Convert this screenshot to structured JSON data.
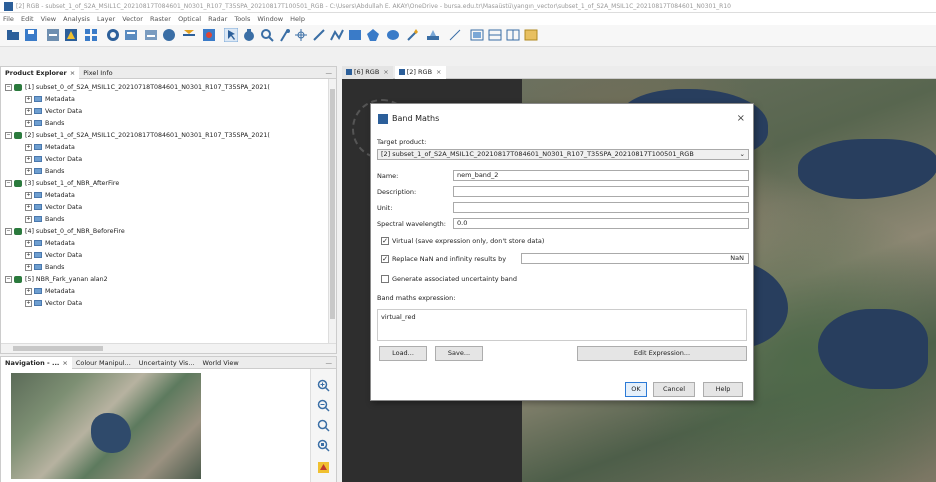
{
  "window": {
    "title": "[2] RGB - subset_1_of_S2A_MSIL1C_20210817T084601_N0301_R107_T35SPA_20210817T100501_RGB - C:\\Users\\Abdullah E. AKAY\\OneDrive - bursa.edu.tr\\Masaüstü\\yangın_vector\\subset_1_of_S2A_MSIL1C_20210817T084601_N0301_R10"
  },
  "menu": [
    "File",
    "Edit",
    "View",
    "Analysis",
    "Layer",
    "Vector",
    "Raster",
    "Optical",
    "Radar",
    "Tools",
    "Window",
    "Help"
  ],
  "product_explorer": {
    "tabs": [
      "Product Explorer",
      "Pixel Info"
    ],
    "close_glyph": "×",
    "minimize_glyph": "—",
    "expand_glyph": "−",
    "collapse_glyph": "+",
    "items": [
      {
        "label": "[1] subset_0_of_S2A_MSIL1C_20210718T084601_N0301_R107_T35SPA_2021(",
        "level": 0
      },
      {
        "label": "Metadata",
        "level": 1
      },
      {
        "label": "Vector Data",
        "level": 1
      },
      {
        "label": "Bands",
        "level": 1
      },
      {
        "label": "[2] subset_1_of_S2A_MSIL1C_20210817T084601_N0301_R107_T35SPA_2021(",
        "level": 0
      },
      {
        "label": "Metadata",
        "level": 1
      },
      {
        "label": "Vector Data",
        "level": 1
      },
      {
        "label": "Bands",
        "level": 1
      },
      {
        "label": "[3] subset_1_of_NBR_AfterFire",
        "level": 0
      },
      {
        "label": "Metadata",
        "level": 1
      },
      {
        "label": "Vector Data",
        "level": 1
      },
      {
        "label": "Bands",
        "level": 1
      },
      {
        "label": "[4] subset_0_of_NBR_BeforeFire",
        "level": 0
      },
      {
        "label": "Metadata",
        "level": 1
      },
      {
        "label": "Vector Data",
        "level": 1
      },
      {
        "label": "Bands",
        "level": 1
      },
      {
        "label": "[5] NBR_Fark_yanan alan2",
        "level": 0
      },
      {
        "label": "Metadata",
        "level": 1
      },
      {
        "label": "Vector Data",
        "level": 1
      }
    ]
  },
  "navigation": {
    "tabs": [
      "Navigation - ...",
      "Colour Manipul...",
      "Uncertainty Vis...",
      "World View"
    ],
    "tools": [
      "zoom-in",
      "zoom-out",
      "zoom-fit",
      "zoom-all",
      "sync"
    ]
  },
  "image_tabs": [
    "[6] RGB",
    "[2] RGB"
  ],
  "dialog": {
    "title": "Band Maths",
    "close": "×",
    "target_product_label": "Target product:",
    "target_product_value": "[2] subset_1_of_S2A_MSIL1C_20210817T084601_N0301_R107_T35SPA_20210817T100501_RGB",
    "name_label": "Name:",
    "name_value": "nem_band_2",
    "description_label": "Description:",
    "description_value": "",
    "unit_label": "Unit:",
    "unit_value": "",
    "wavelength_label": "Spectral wavelength:",
    "wavelength_value": "0.0",
    "virtual_label": "Virtual (save expression only, don't store data)",
    "virtual_checked": true,
    "replace_nan_label": "Replace NaN and infinity results by",
    "replace_nan_checked": true,
    "replace_nan_value": "NaN",
    "uncertainty_label": "Generate associated uncertainty band",
    "uncertainty_checked": false,
    "expression_label": "Band maths expression:",
    "expression_value": "virtual_red",
    "load_button": "Load...",
    "save_button": "Save...",
    "edit_button": "Edit Expression...",
    "ok_button": "OK",
    "cancel_button": "Cancel",
    "help_button": "Help",
    "check_glyph": "✓",
    "dropdown_glyph": "⌄"
  }
}
